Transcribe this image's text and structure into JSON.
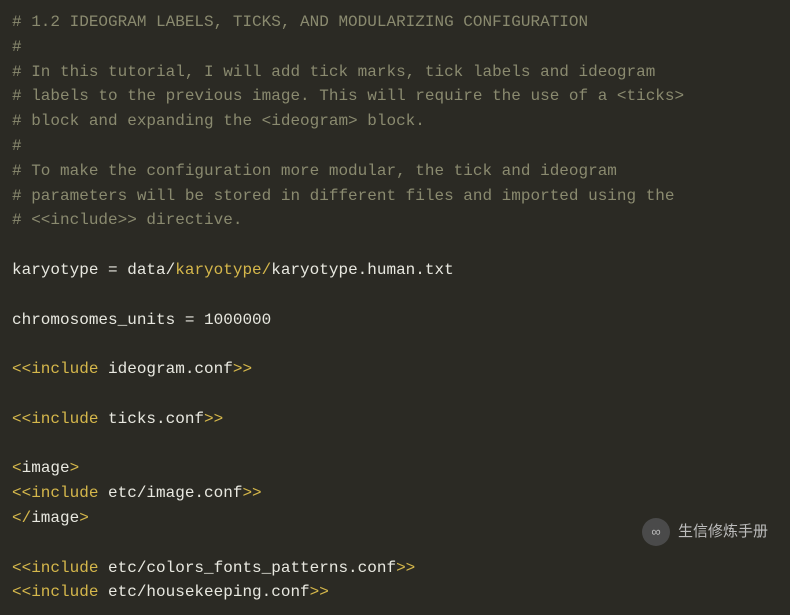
{
  "code": {
    "lines": [
      {
        "type": "comment",
        "text": "# 1.2 IDEOGRAM LABELS, TICKS, AND MODULARIZING CONFIGURATION"
      },
      {
        "type": "comment",
        "text": "#"
      },
      {
        "type": "comment",
        "text": "# In this tutorial, I will add tick marks, tick labels and ideogram"
      },
      {
        "type": "comment",
        "text": "# labels to the previous image. This will require the use of a <ticks>"
      },
      {
        "type": "comment",
        "text": "# block and expanding the <ideogram> block."
      },
      {
        "type": "comment",
        "text": "#"
      },
      {
        "type": "comment",
        "text": "# To make the configuration more modular, the tick and ideogram"
      },
      {
        "type": "comment",
        "text": "# parameters will be stored in different files and imported using the"
      },
      {
        "type": "comment",
        "text": "# <<include>> directive."
      },
      {
        "type": "blank",
        "text": ""
      },
      {
        "type": "assign",
        "lhs": "karyotype = data/",
        "mid": "karyotype/",
        "rhs": "karyotype.human.txt"
      },
      {
        "type": "blank",
        "text": ""
      },
      {
        "type": "plain",
        "text": "chromosomes_units = 1000000"
      },
      {
        "type": "blank",
        "text": ""
      },
      {
        "type": "include",
        "open": "<<include ",
        "file": "ideogram.conf",
        "close": ">>"
      },
      {
        "type": "blank",
        "text": ""
      },
      {
        "type": "include",
        "open": "<<include ",
        "file": "ticks.conf",
        "close": ">>"
      },
      {
        "type": "blank",
        "text": ""
      },
      {
        "type": "tag",
        "open": "<",
        "name": "image",
        "close": ">"
      },
      {
        "type": "include",
        "open": "<<include ",
        "file": "etc/image.conf",
        "close": ">>"
      },
      {
        "type": "tag",
        "open": "</",
        "name": "image",
        "close": ">"
      },
      {
        "type": "blank",
        "text": ""
      },
      {
        "type": "include",
        "open": "<<include ",
        "file": "etc/colors_fonts_patterns.conf",
        "close": ">>"
      },
      {
        "type": "include",
        "open": "<<include ",
        "file": "etc/housekeeping.conf",
        "close": ">>"
      }
    ]
  },
  "watermark": {
    "text": "生信修炼手册",
    "icon_glyph": "∞"
  }
}
